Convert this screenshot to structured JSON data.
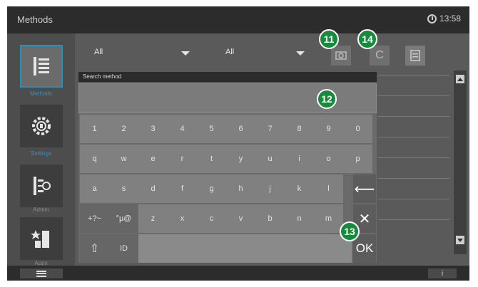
{
  "topbar": {
    "title": "Methods",
    "time": "13:58"
  },
  "nav": {
    "items": [
      {
        "label": "Methods",
        "icon": "methods-list-icon",
        "active": true
      },
      {
        "label": "Settings",
        "icon": "settings-gear-icon",
        "active": false
      },
      {
        "label": "Admin",
        "icon": "admin-icon",
        "active": false
      },
      {
        "label": "Apps",
        "icon": "apps-icon",
        "active": false
      }
    ]
  },
  "filters": {
    "first": "All",
    "second": "All"
  },
  "toolbar": {
    "clear_label": "C"
  },
  "search": {
    "header": "Search method",
    "value": "",
    "rows": [
      [
        "1",
        "2",
        "3",
        "4",
        "5",
        "6",
        "7",
        "8",
        "9",
        "0"
      ],
      [
        "q",
        "w",
        "e",
        "r",
        "t",
        "y",
        "u",
        "i",
        "o",
        "p"
      ],
      [
        "a",
        "s",
        "d",
        "f",
        "g",
        "h",
        "j",
        "k",
        "l"
      ],
      [
        "+?~",
        "°µ@",
        "z",
        "x",
        "c",
        "v",
        "b",
        "n",
        "m"
      ],
      [
        "⇧",
        "ID"
      ]
    ],
    "backspace": "⟵",
    "clear": "✕",
    "ok": "OK"
  },
  "markers": [
    "11",
    "12",
    "13",
    "14"
  ],
  "bottombar": {
    "info": "i"
  },
  "colors": {
    "accent": "#2a8fb8",
    "marker": "#178a3c"
  }
}
